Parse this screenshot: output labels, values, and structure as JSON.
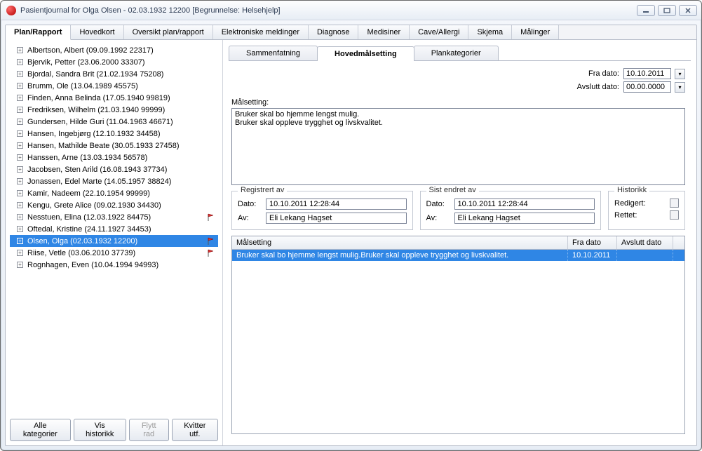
{
  "window": {
    "title": "Pasientjournal for Olga Olsen - 02.03.1932 12200   [Begrunnelse: Helsehjelp]"
  },
  "tabs": [
    "Plan/Rapport",
    "Hovedkort",
    "Oversikt plan/rapport",
    "Elektroniske meldinger",
    "Diagnose",
    "Medisiner",
    "Cave/Allergi",
    "Skjema",
    "Målinger"
  ],
  "active_tab": 0,
  "patients": [
    {
      "label": "Albertson, Albert (09.09.1992 22317)",
      "flag": false
    },
    {
      "label": "Bjervik, Petter (23.06.2000 33307)",
      "flag": false
    },
    {
      "label": "Bjordal, Sandra Brit (21.02.1934 75208)",
      "flag": false
    },
    {
      "label": "Brumm, Ole (13.04.1989 45575)",
      "flag": false
    },
    {
      "label": "Finden, Anna Belinda (17.05.1940 99819)",
      "flag": false
    },
    {
      "label": "Fredriksen, Wilhelm (21.03.1940 99999)",
      "flag": false
    },
    {
      "label": "Gundersen, Hilde Guri (11.04.1963 46671)",
      "flag": false
    },
    {
      "label": "Hansen, Ingebjørg (12.10.1932 34458)",
      "flag": false
    },
    {
      "label": "Hansen, Mathilde Beate (30.05.1933 27458)",
      "flag": false
    },
    {
      "label": "Hanssen, Arne (13.03.1934 56578)",
      "flag": false
    },
    {
      "label": "Jacobsen, Sten Arild (16.08.1943 37734)",
      "flag": false
    },
    {
      "label": "Jonassen, Edel Marte (14.05.1957 38824)",
      "flag": false
    },
    {
      "label": "Kamir, Nadeem (22.10.1954 99999)",
      "flag": false
    },
    {
      "label": "Kengu, Grete Alice (09.02.1930 34430)",
      "flag": false
    },
    {
      "label": "Nesstuen, Elina (12.03.1922 84475)",
      "flag": true
    },
    {
      "label": "Oftedal, Kristine (24.11.1927 34453)",
      "flag": false
    },
    {
      "label": "Olsen, Olga (02.03.1932 12200)",
      "flag": true,
      "selected": true
    },
    {
      "label": "Riise, Vetle (03.06.2010 37739)",
      "flag": true
    },
    {
      "label": "Rognhagen, Even (10.04.1994 94993)",
      "flag": false
    }
  ],
  "buttons": {
    "alle_kategorier": "Alle kategorier",
    "vis_historikk": "Vis historikk",
    "flytt_rad": "Flytt rad",
    "kvitter_utf": "Kvitter utf."
  },
  "subtabs": [
    "Sammenfatning",
    "Hovedmålsetting",
    "Plankategorier"
  ],
  "active_subtab": 1,
  "dates": {
    "fra_label": "Fra dato:",
    "fra_value": "10.10.2011",
    "avslutt_label": "Avslutt dato:",
    "avslutt_value": "00.00.0000"
  },
  "malsetting": {
    "label": "Målsetting:",
    "text": "Bruker skal bo hjemme lengst mulig.\nBruker skal oppleve trygghet og livskvalitet."
  },
  "registrert": {
    "legend": "Registrert av",
    "dato_label": "Dato:",
    "dato_value": "10.10.2011  12:28:44",
    "av_label": "Av:",
    "av_value": "Eli Lekang Hagset"
  },
  "sist_endret": {
    "legend": "Sist endret av",
    "dato_label": "Dato:",
    "dato_value": "10.10.2011  12:28:44",
    "av_label": "Av:",
    "av_value": "Eli Lekang Hagset"
  },
  "historikk": {
    "legend": "Historikk",
    "redigert_label": "Redigert:",
    "rettet_label": "Rettet:"
  },
  "grid": {
    "headers": [
      "Målsetting",
      "Fra dato",
      "Avslutt dato"
    ],
    "row": {
      "text": "Bruker skal bo hjemme lengst mulig.Bruker skal oppleve trygghet og livskvalitet.",
      "fra": "10.10.2011",
      "avslutt": ""
    }
  }
}
